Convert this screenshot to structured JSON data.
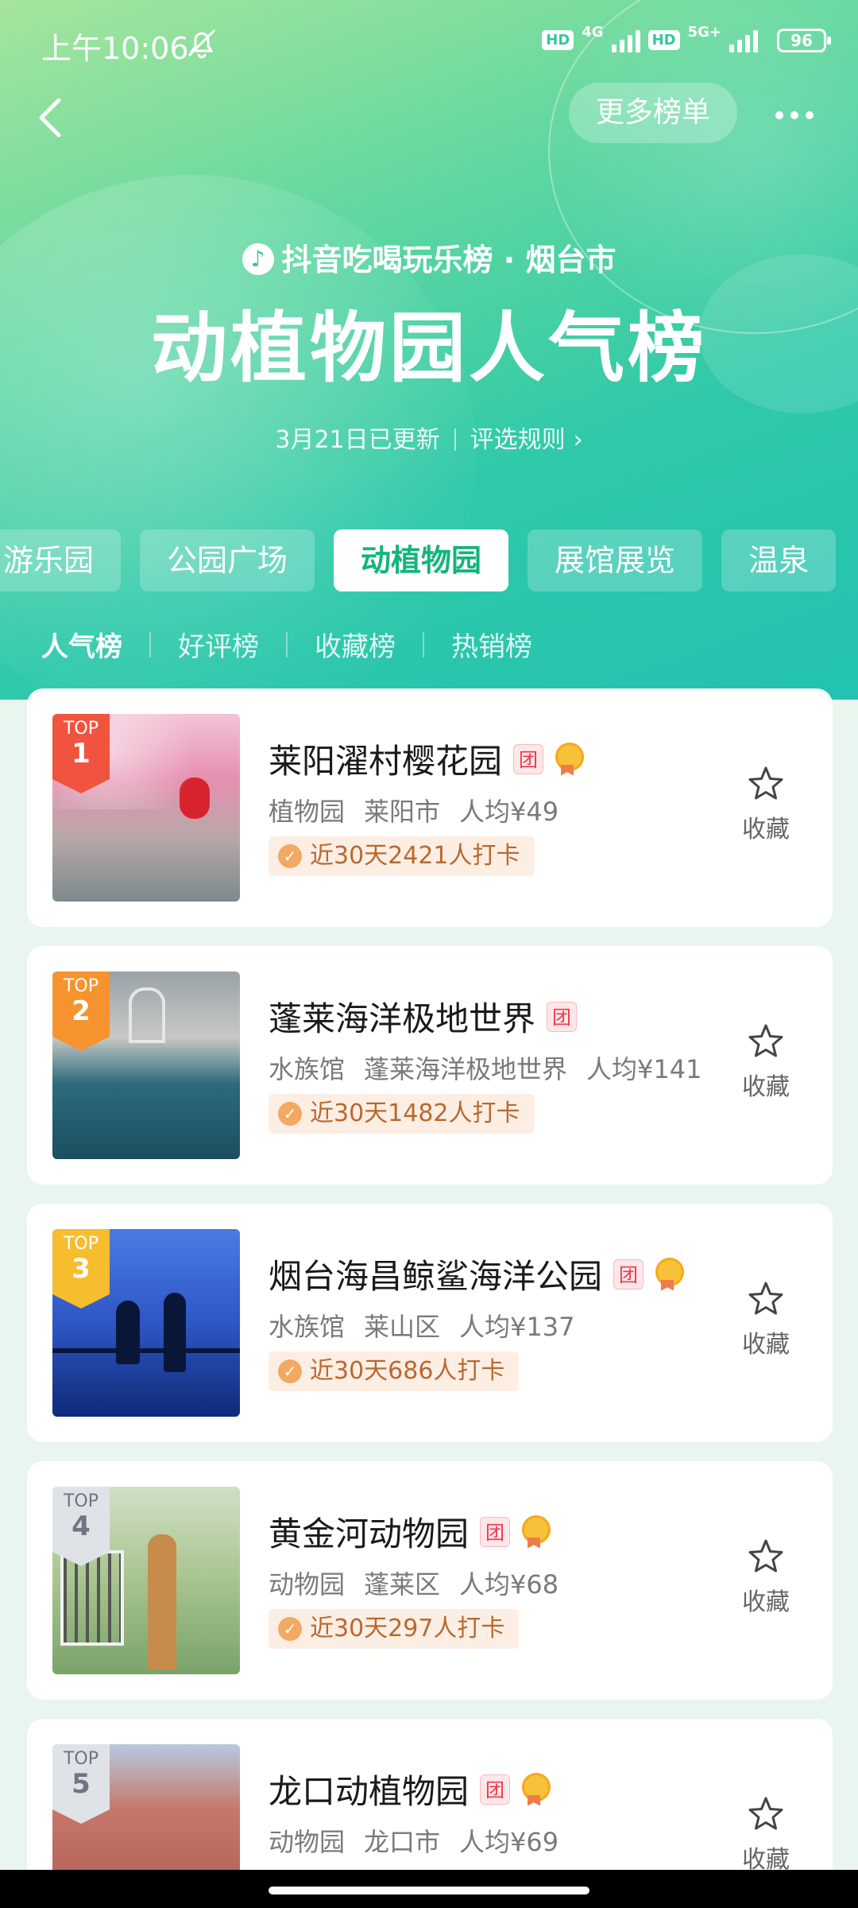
{
  "status_bar": {
    "time": "上午10:06",
    "net1_label": "4G",
    "net2_label": "5G+",
    "hd_label": "HD",
    "battery": "96"
  },
  "nav": {
    "more_lists": "更多榜单"
  },
  "header": {
    "brand": "抖音吃喝玩乐榜 · 烟台市",
    "title": "动植物园人气榜",
    "updated": "3月21日已更新",
    "rules": "评选规则"
  },
  "category_tabs": [
    {
      "label": "游乐园",
      "active": false
    },
    {
      "label": "公园广场",
      "active": false
    },
    {
      "label": "动植物园",
      "active": true
    },
    {
      "label": "展馆展览",
      "active": false
    },
    {
      "label": "温泉",
      "active": false
    }
  ],
  "rank_tabs": [
    {
      "label": "人气榜",
      "active": true
    },
    {
      "label": "好评榜",
      "active": false
    },
    {
      "label": "收藏榜",
      "active": false
    },
    {
      "label": "热销榜",
      "active": false
    }
  ],
  "top_label": "TOP",
  "tuan_label": "团",
  "fav_label": "收藏",
  "items": [
    {
      "rank": "1",
      "name": "莱阳濯村樱花园",
      "type": "植物园",
      "area": "莱阳市",
      "price": "人均¥49",
      "checkins": "近30天2421人打卡",
      "medal": true,
      "badge_color": "#f0533e"
    },
    {
      "rank": "2",
      "name": "蓬莱海洋极地世界",
      "type": "水族馆",
      "area": "蓬莱海洋极地世界",
      "price": "人均¥141",
      "checkins": "近30天1482人打卡",
      "medal": false,
      "badge_color": "#f6932e"
    },
    {
      "rank": "3",
      "name": "烟台海昌鲸鲨海洋公园",
      "type": "水族馆",
      "area": "莱山区",
      "price": "人均¥137",
      "checkins": "近30天686人打卡",
      "medal": true,
      "badge_color": "#f6bd2e"
    },
    {
      "rank": "4",
      "name": "黄金河动物园",
      "type": "动物园",
      "area": "蓬莱区",
      "price": "人均¥68",
      "checkins": "近30天297人打卡",
      "medal": true,
      "badge_color": "#dfe3e8"
    },
    {
      "rank": "5",
      "name": "龙口动植物园",
      "type": "动物园",
      "area": "龙口市",
      "price": "人均¥69",
      "checkins": "",
      "medal": true,
      "badge_color": "#dfe3e8"
    }
  ]
}
